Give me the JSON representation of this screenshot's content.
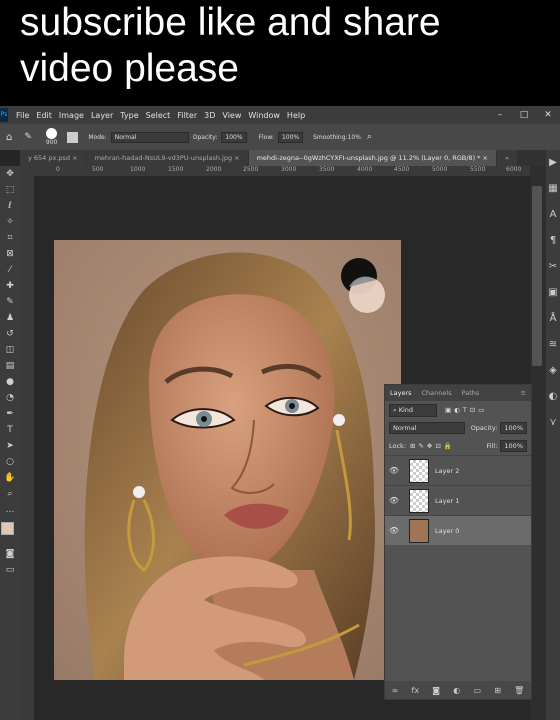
{
  "caption": {
    "line1": "subscribe like and share",
    "line2": "video please"
  },
  "app": {
    "logo": "Ps",
    "menu": [
      "File",
      "Edit",
      "Image",
      "Layer",
      "Type",
      "Select",
      "Filter",
      "3D",
      "View",
      "Window",
      "Help"
    ],
    "window_buttons": [
      "–",
      "□",
      "✕"
    ]
  },
  "options": {
    "brush_size": "900",
    "mode_label": "Mode:",
    "mode_value": "Normal",
    "opacity_label": "Opacity:",
    "opacity_value": "100%",
    "flow_label": "Flow:",
    "flow_value": "100%",
    "smoothing_label": "Smoothing:",
    "smoothing_value": "10%"
  },
  "tabs": [
    "y 654 px.psd ×",
    "mehran-hadad-NsUL9-vd3PU-unsplash.jpg ×",
    "mehdi-zegna--0gWzhCYXFI-unsplash.jpg @ 11.2% (Layer 0, RGB/8) * ×",
    "»"
  ],
  "ruler": [
    "0",
    "500",
    "1000",
    "1500",
    "2000",
    "2500",
    "3000",
    "3500",
    "4000",
    "4500",
    "5000",
    "5500",
    "6000"
  ],
  "layers_panel": {
    "tabs": [
      "Layers",
      "Channels",
      "Paths"
    ],
    "kind_label": "Kind",
    "blend": "Normal",
    "opacity_label": "Opacity:",
    "opacity_value": "100%",
    "lock_label": "Lock:",
    "fill_label": "Fill:",
    "fill_value": "100%",
    "layers": [
      "Layer 2",
      "Layer 1",
      "Layer 0"
    ],
    "active_layer": "Layer 0"
  },
  "colors": {
    "photo_bg": "#a98a73",
    "swatch_dark": "#111111",
    "swatch_light": "#ecd2c2",
    "ps_blue": "#31a8ff"
  }
}
